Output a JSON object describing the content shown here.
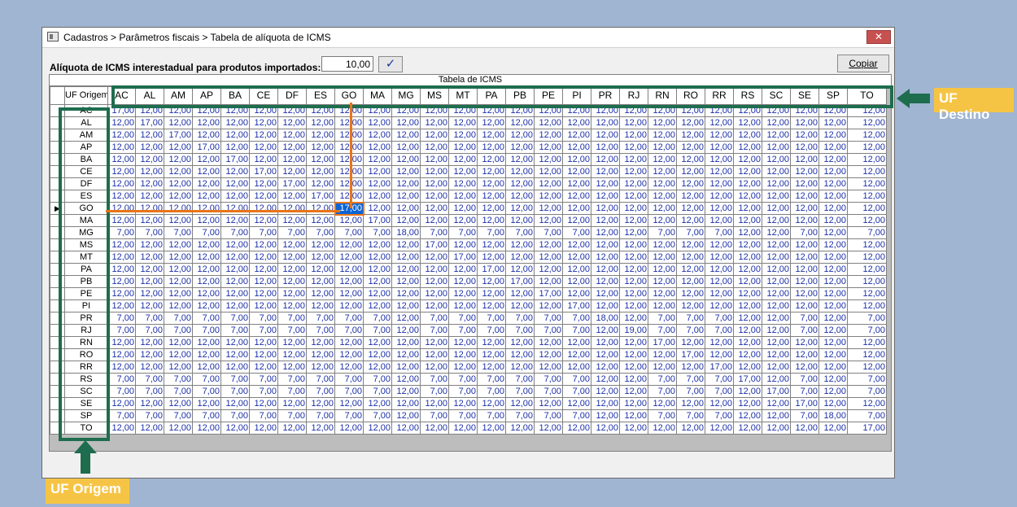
{
  "window": {
    "title": "Cadastros > Parâmetros fiscais > Tabela de alíquota de ICMS",
    "close_symbol": "✕"
  },
  "aliquota": {
    "label": "Alíquota de ICMS interestadual para produtos importados:",
    "value": "10,00",
    "confirm_symbol": "✓"
  },
  "copy_button": "Copiar",
  "table": {
    "caption": "Tabela de ICMS",
    "row_header_title": "UF Origem",
    "selected": {
      "row": "GO",
      "col": "GO"
    },
    "columns": [
      "AC",
      "AL",
      "AM",
      "AP",
      "BA",
      "CE",
      "DF",
      "ES",
      "GO",
      "MA",
      "MG",
      "MS",
      "MT",
      "PA",
      "PB",
      "PE",
      "PI",
      "PR",
      "RJ",
      "RN",
      "RO",
      "RR",
      "RS",
      "SC",
      "SE",
      "SP",
      "TO"
    ],
    "rows": [
      "AC",
      "AL",
      "AM",
      "AP",
      "BA",
      "CE",
      "DF",
      "ES",
      "GO",
      "MA",
      "MG",
      "MS",
      "MT",
      "PA",
      "PB",
      "PE",
      "PI",
      "PR",
      "RJ",
      "RN",
      "RO",
      "RR",
      "RS",
      "SC",
      "SE",
      "SP",
      "TO"
    ],
    "south_southeast": [
      "MG",
      "PR",
      "RJ",
      "RS",
      "SC",
      "SP"
    ],
    "internal_rates": {
      "MA": "17,00",
      "MG": "18,00",
      "PR": "18,00",
      "RJ": "19,00",
      "SP": "18,00"
    },
    "default_internal": "17,00",
    "rate_12": "12,00",
    "rate_7": "7,00"
  },
  "annotations": {
    "uf_destino": "UF Destino",
    "uf_origem": "UF Origem"
  }
}
